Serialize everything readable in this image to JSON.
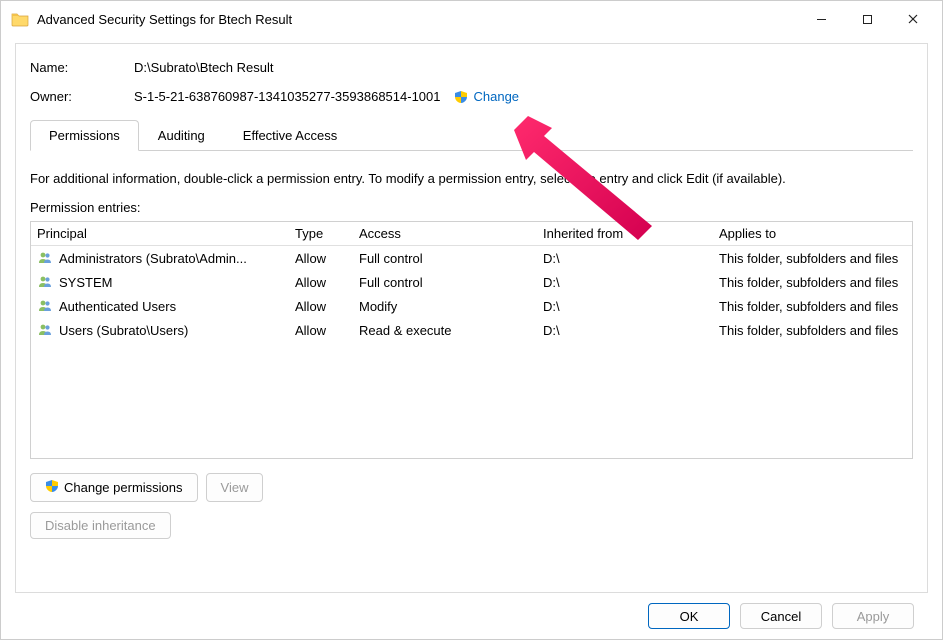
{
  "titlebar": {
    "title": "Advanced Security Settings for Btech Result"
  },
  "info": {
    "name_label": "Name:",
    "name_value": "D:\\Subrato\\Btech Result",
    "owner_label": "Owner:",
    "owner_value": "S-1-5-21-638760987-1341035277-3593868514-1001",
    "change_link": "Change"
  },
  "tabs": {
    "permissions": "Permissions",
    "auditing": "Auditing",
    "effective_access": "Effective Access"
  },
  "instruction": "For additional information, double-click a permission entry. To modify a permission entry, select the entry and click Edit (if available).",
  "entries_label": "Permission entries:",
  "columns": {
    "principal": "Principal",
    "type": "Type",
    "access": "Access",
    "inherited": "Inherited from",
    "applies": "Applies to"
  },
  "entries": [
    {
      "principal": "Administrators (Subrato\\Admin...",
      "type": "Allow",
      "access": "Full control",
      "inherited": "D:\\",
      "applies": "This folder, subfolders and files"
    },
    {
      "principal": "SYSTEM",
      "type": "Allow",
      "access": "Full control",
      "inherited": "D:\\",
      "applies": "This folder, subfolders and files"
    },
    {
      "principal": "Authenticated Users",
      "type": "Allow",
      "access": "Modify",
      "inherited": "D:\\",
      "applies": "This folder, subfolders and files"
    },
    {
      "principal": "Users (Subrato\\Users)",
      "type": "Allow",
      "access": "Read & execute",
      "inherited": "D:\\",
      "applies": "This folder, subfolders and files"
    }
  ],
  "buttons": {
    "change_permissions": "Change permissions",
    "view": "View",
    "disable_inheritance": "Disable inheritance",
    "ok": "OK",
    "cancel": "Cancel",
    "apply": "Apply"
  }
}
